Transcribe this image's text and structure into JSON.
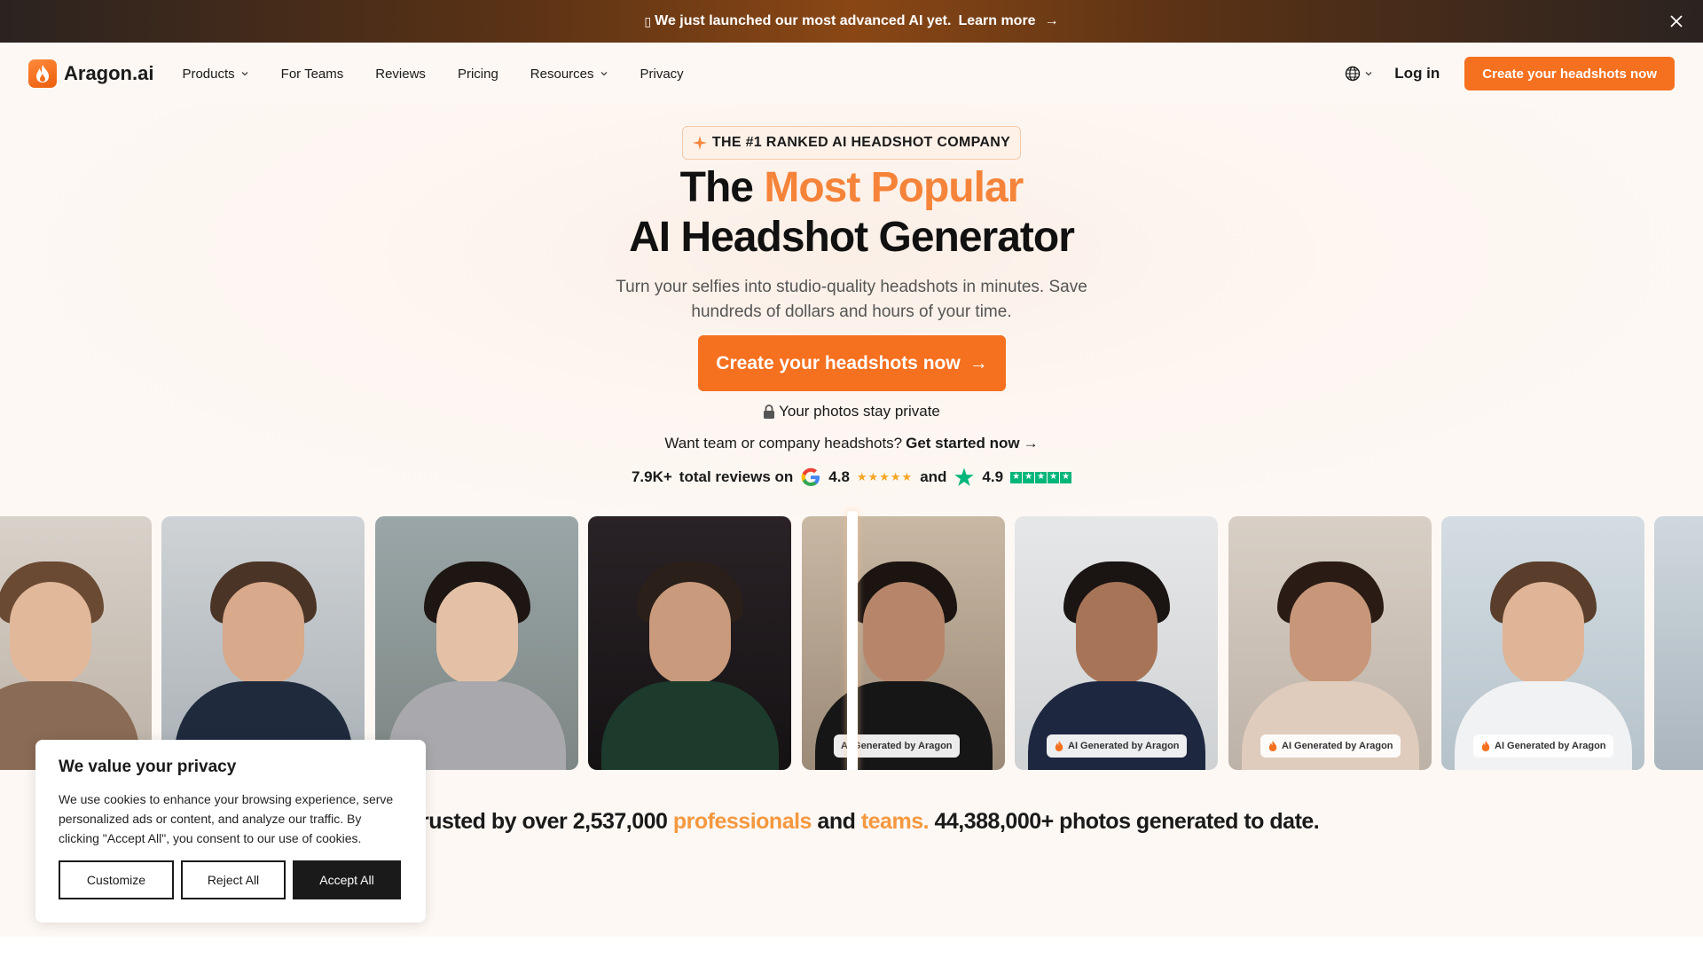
{
  "announcement": {
    "glyph": "▯",
    "text": "We just launched our most advanced AI yet.",
    "link": "Learn more",
    "arrow": "→"
  },
  "nav": {
    "logo_text": "Aragon.ai",
    "items": [
      {
        "label": "Products",
        "dropdown": true
      },
      {
        "label": "For Teams",
        "dropdown": false
      },
      {
        "label": "Reviews",
        "dropdown": false
      },
      {
        "label": "Pricing",
        "dropdown": false
      },
      {
        "label": "Resources",
        "dropdown": true
      },
      {
        "label": "Privacy",
        "dropdown": false
      }
    ],
    "login": "Log in",
    "cta": "Create your headshots now"
  },
  "hero": {
    "badge": "THE #1 RANKED AI HEADSHOT COMPANY",
    "headline_prefix": "The",
    "headline_accent": "Most Popular",
    "headline_line2": "AI Headshot Generator",
    "subhead": "Turn your selfies into studio-quality headshots in minutes. Save hundreds of dollars and hours of your time.",
    "cta": "Create your headshots now",
    "cta_arrow": "→",
    "privacy": "Your photos stay private",
    "teams_prefix": "Want team or company headshots?",
    "teams_link": "Get started now",
    "teams_arrow": "→",
    "reviews_count": "7.9K+",
    "reviews_label": "total reviews on",
    "google_rating": "4.8",
    "google_stars": "★★★★★",
    "and": "and",
    "trustpilot_rating": "4.9",
    "trustpilot_star": "★"
  },
  "photos": {
    "badge_label": "AI Generated by Aragon"
  },
  "trusted": {
    "prefix": "rusted by over 2,537,000",
    "professionals": "professionals",
    "and": "and",
    "teams": "teams.",
    "suffix": "44,388,000+ photos generated to date."
  },
  "cookie": {
    "title": "We value your privacy",
    "body": "We use cookies to enhance your browsing experience, serve personalized ads or content, and analyze our traffic. By clicking \"Accept All\", you consent to our use of cookies.",
    "customize": "Customize",
    "reject": "Reject All",
    "accept": "Accept All"
  },
  "colors": {
    "brand_orange": "#f5701f",
    "accent_orange": "#f5843a"
  }
}
